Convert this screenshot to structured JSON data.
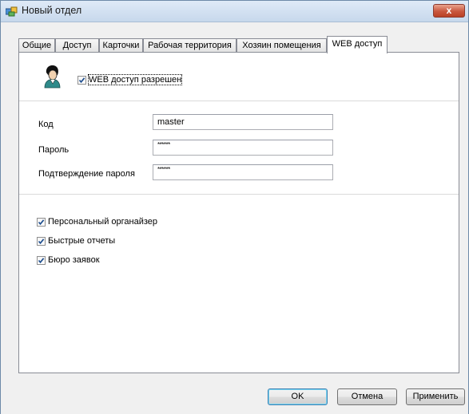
{
  "window": {
    "title": "Новый отдел",
    "close_label": "x"
  },
  "tabs": [
    {
      "label": "Общие"
    },
    {
      "label": "Доступ"
    },
    {
      "label": "Карточки"
    },
    {
      "label": "Рабочая территория"
    },
    {
      "label": "Хозяин помещения"
    },
    {
      "label": "WEB доступ",
      "active": true
    }
  ],
  "web_access": {
    "enabled_label": "WEB доступ разрешен",
    "enabled": true
  },
  "credentials": {
    "login_label": "Код",
    "login_value": "master",
    "password_label": "Пароль",
    "password_value": "******",
    "confirm_label": "Подтверждение пароля",
    "confirm_value": "******"
  },
  "modules": [
    {
      "label": "Персональный органайзер",
      "checked": true
    },
    {
      "label": "Быстрые отчеты",
      "checked": true
    },
    {
      "label": "Бюро заявок",
      "checked": true
    }
  ],
  "buttons": {
    "ok": "OK",
    "cancel": "Отмена",
    "apply": "Применить"
  },
  "colors": {
    "check": "#1f4f8f",
    "title_bg": "#c7d8ec",
    "close_red": "#c9573e"
  }
}
